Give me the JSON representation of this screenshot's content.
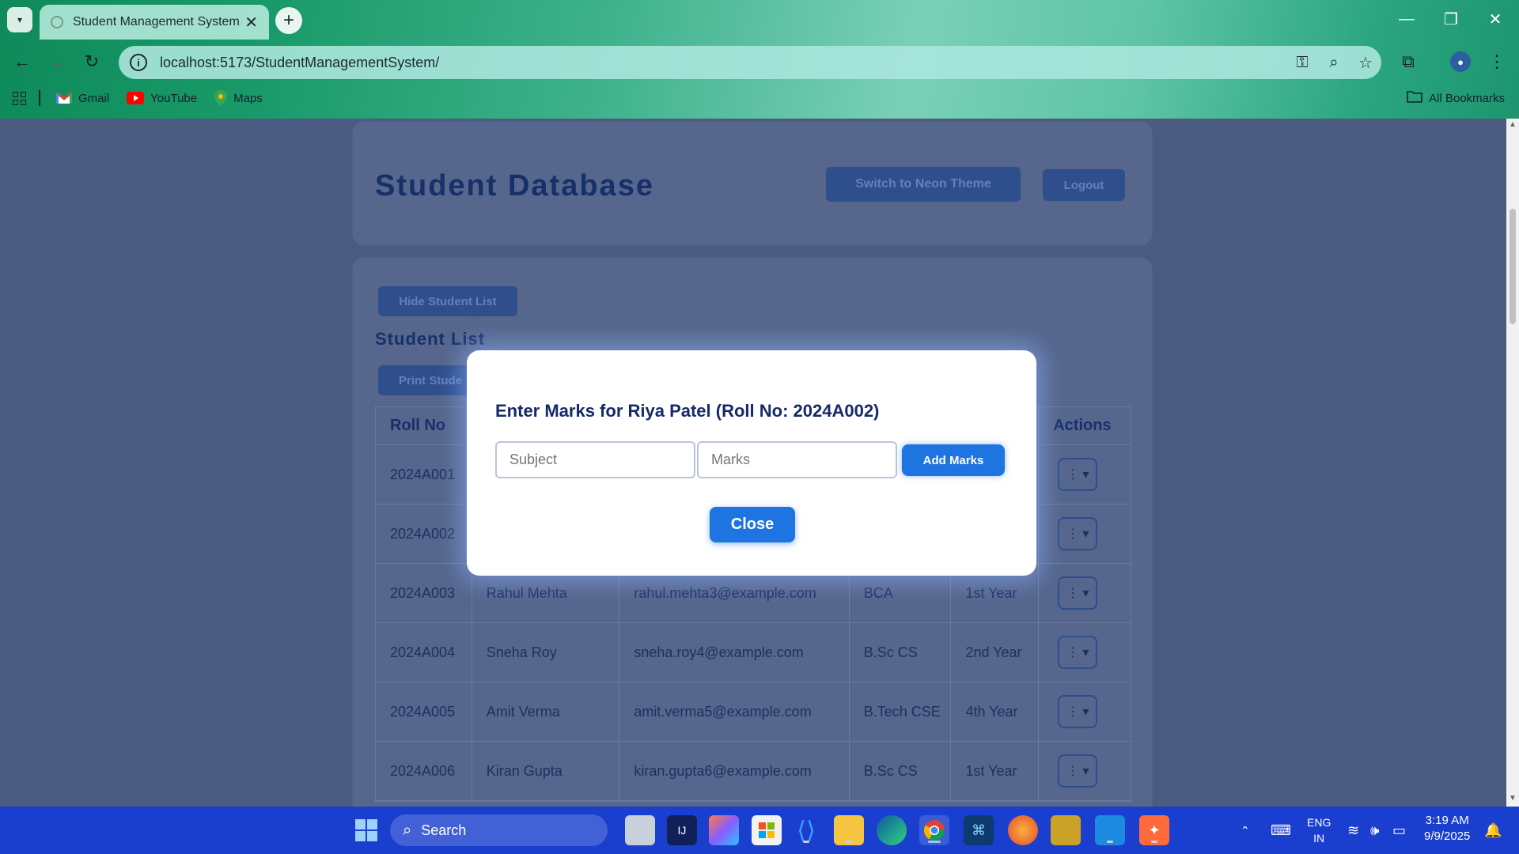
{
  "browser": {
    "tab_title": "Student Management System",
    "url": "localhost:5173/StudentManagementSystem/",
    "bookmarks": [
      {
        "label": "Gmail",
        "icon": "gmail-icon"
      },
      {
        "label": "YouTube",
        "icon": "youtube-icon"
      },
      {
        "label": "Maps",
        "icon": "maps-icon"
      }
    ],
    "all_bookmarks": "All Bookmarks"
  },
  "header": {
    "title": "Student Database",
    "theme_button": "Switch to Neon Theme",
    "logout_button": "Logout"
  },
  "student_list": {
    "toggle_button": "Hide Student List",
    "title": "Student List",
    "print_button": "Print Stude",
    "columns": [
      "Roll No",
      "",
      "",
      "",
      "",
      "Actions"
    ],
    "rows": [
      {
        "roll": "2024A001",
        "name": "",
        "email": "",
        "course": "",
        "year": ""
      },
      {
        "roll": "2024A002",
        "name": "",
        "email": "",
        "course": "",
        "year": ""
      },
      {
        "roll": "2024A003",
        "name": "Rahul Mehta",
        "email": "rahul.mehta3@example.com",
        "course": "BCA",
        "year": "1st Year"
      },
      {
        "roll": "2024A004",
        "name": "Sneha Roy",
        "email": "sneha.roy4@example.com",
        "course": "B.Sc CS",
        "year": "2nd Year"
      },
      {
        "roll": "2024A005",
        "name": "Amit Verma",
        "email": "amit.verma5@example.com",
        "course": "B.Tech CSE",
        "year": "4th Year"
      },
      {
        "roll": "2024A006",
        "name": "Kiran Gupta",
        "email": "kiran.gupta6@example.com",
        "course": "B.Sc CS",
        "year": "1st Year"
      }
    ]
  },
  "modal": {
    "title": "Enter Marks for Riya Patel (Roll No: 2024A002)",
    "subject_placeholder": "Subject",
    "marks_placeholder": "Marks",
    "add_button": "Add Marks",
    "close_button": "Close"
  },
  "taskbar": {
    "search_label": "Search",
    "lang_top": "ENG",
    "lang_bottom": "IN",
    "time": "3:19 AM",
    "date": "9/9/2025"
  },
  "colors": {
    "accent": "#1e74e0",
    "modal_title": "#152a6a",
    "overlay_bg": "#4a5a80",
    "taskbar": "#1a3fcf"
  }
}
